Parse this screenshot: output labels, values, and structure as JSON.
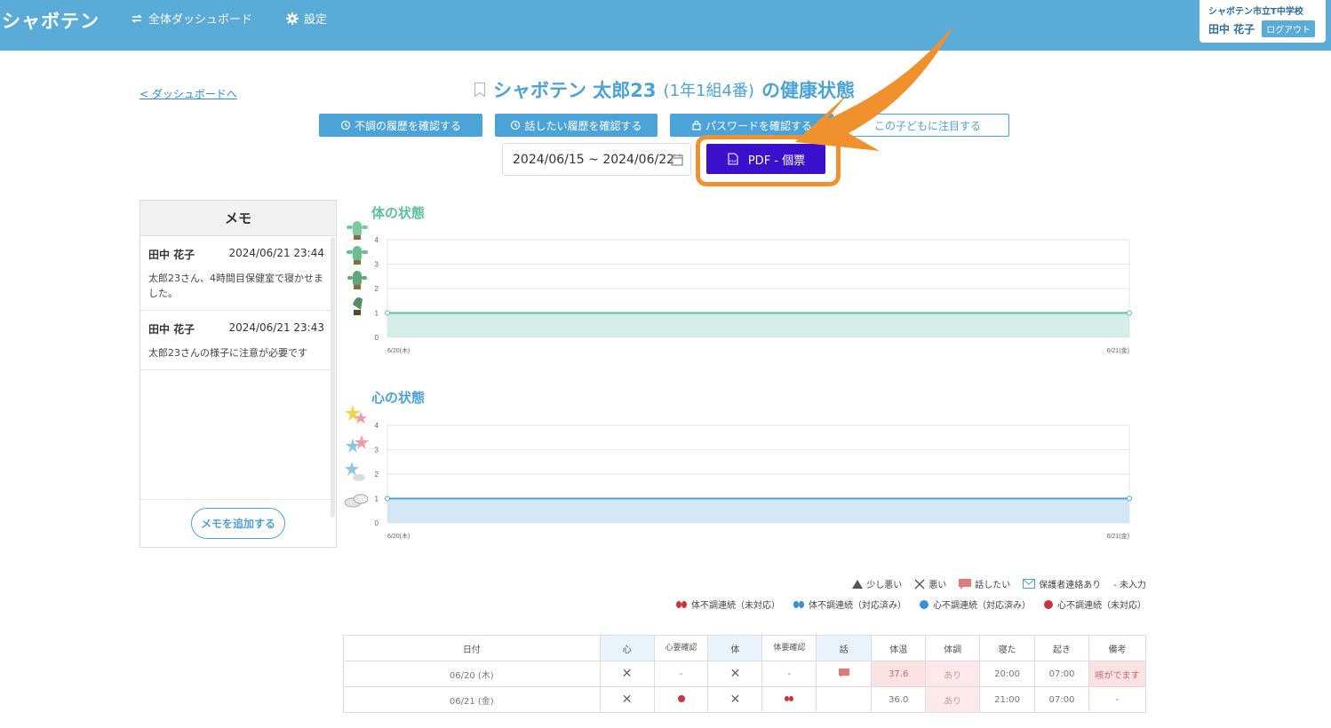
{
  "header": {
    "logo": "シャボテン",
    "nav": [
      {
        "label": "全体ダッシュボード",
        "icon": "refresh-icon"
      },
      {
        "label": "設定",
        "icon": "gear-icon"
      }
    ],
    "school": "シャボテン市立T中学校",
    "user_name": "田中 花子",
    "logout": "ログアウト"
  },
  "back_link": "< ダッシュボードへ",
  "title": {
    "name": "シャボテン 太郎23",
    "class_info": "(1年1組4番)",
    "suffix": "の健康状態"
  },
  "actions": [
    {
      "label": "不調の履歴を確認する",
      "icon": "history-icon"
    },
    {
      "label": "話したい履歴を確認する",
      "icon": "history-icon"
    },
    {
      "label": "パスワードを確認する",
      "icon": "lock-icon"
    },
    {
      "label": "この子どもに注目する",
      "icon": "star-icon"
    }
  ],
  "date_range": "2024/06/15 ~ 2024/06/22",
  "pdf_button": "PDF - 個票",
  "memo": {
    "heading": "メモ",
    "items": [
      {
        "author": "田中 花子",
        "datetime": "2024/06/21 23:44",
        "text": "太郎23さん、4時間目保健室で寝かせました。"
      },
      {
        "author": "田中 花子",
        "datetime": "2024/06/21 23:43",
        "text": "太郎23さんの様子に注意が必要です"
      }
    ],
    "add_button": "メモを追加する"
  },
  "chart_data": [
    {
      "type": "area",
      "title": "体の状態",
      "x": [
        "6/20(木)",
        "6/21(金)"
      ],
      "yticks": [
        0,
        1,
        2,
        3,
        4
      ],
      "ylim": [
        0,
        4
      ],
      "series": [
        {
          "values": [
            1,
            1
          ]
        }
      ],
      "color": "#5dbf9f",
      "fill": "#d6eee9"
    },
    {
      "type": "area",
      "title": "心の状態",
      "x": [
        "6/20(木)",
        "6/21(金)"
      ],
      "yticks": [
        0,
        1,
        2,
        3,
        4
      ],
      "ylim": [
        0,
        4
      ],
      "series": [
        {
          "values": [
            1,
            1
          ]
        }
      ],
      "color": "#4ca3d8",
      "fill": "#d3e8f4"
    }
  ],
  "legend": {
    "row1": [
      "少し悪い",
      "悪い",
      "話したい",
      "保護者連絡あり",
      "- 未入力"
    ],
    "row2": [
      "体不調連続（未対応）",
      "体不調連続（対応済み）",
      "心不調連続（対応済み）",
      "心不調連続（未対応）"
    ]
  },
  "table": {
    "headers": [
      "日付",
      "心",
      "心要確認",
      "体",
      "体要確認",
      "話",
      "体温",
      "体調",
      "寝た",
      "起き",
      "備考"
    ],
    "rows": [
      {
        "date": "06/20 (木)",
        "mind": "✕",
        "mind_check": "-",
        "body": "✕",
        "body_check": "-",
        "talk": "",
        "temp": "37.6",
        "condition": "あり",
        "slept": "20:00",
        "woke": "07:00",
        "note": "咳がでます"
      },
      {
        "date": "06/21 (金)",
        "mind": "✕",
        "mind_check": "",
        "body": "✕",
        "body_check": "",
        "talk": "",
        "temp": "36.0",
        "condition": "あり",
        "slept": "21:00",
        "woke": "07:00",
        "note": "-"
      }
    ]
  }
}
